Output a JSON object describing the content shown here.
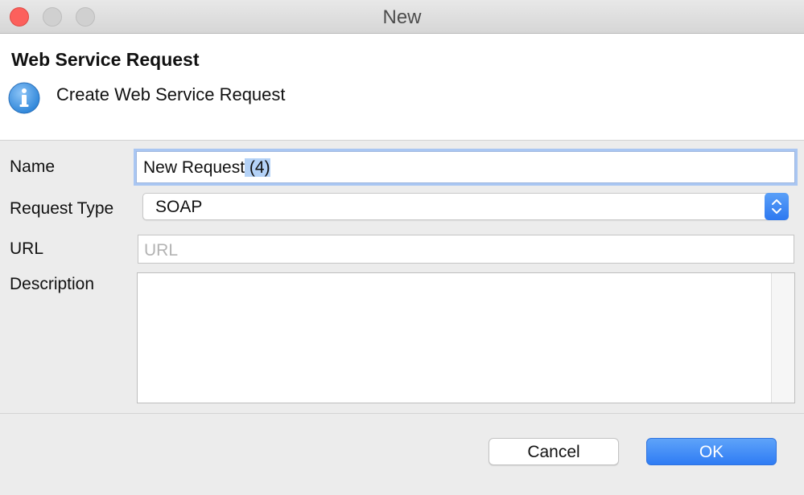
{
  "window": {
    "title": "New"
  },
  "header": {
    "title": "Web Service Request",
    "description": "Create Web Service Request",
    "icon": "info-icon"
  },
  "form": {
    "name_label": "Name",
    "name_value": "New Request",
    "name_selected_suffix": " (4)",
    "request_type_label": "Request Type",
    "request_type_value": "SOAP",
    "url_label": "URL",
    "url_placeholder": "URL",
    "url_value": "",
    "description_label": "Description",
    "description_value": ""
  },
  "buttons": {
    "cancel": "Cancel",
    "ok": "OK"
  },
  "colors": {
    "accent": "#3b86f6",
    "close_button": "#fc605c",
    "selection": "#b4d2f7"
  }
}
